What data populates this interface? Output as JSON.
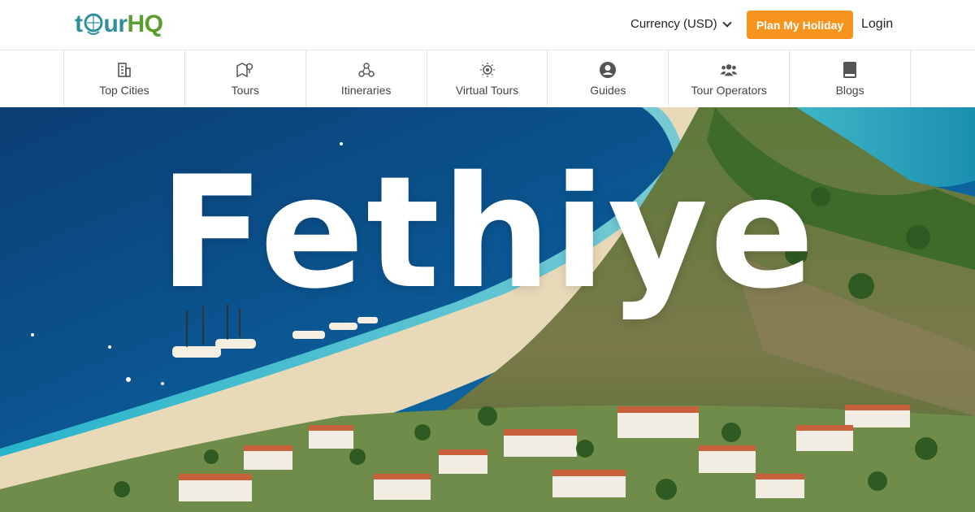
{
  "header": {
    "logo_text": "tourHQ",
    "currency_label": "Currency (USD)",
    "plan_button": "Plan My Holiday",
    "login": "Login"
  },
  "nav": {
    "items": [
      {
        "label": "Top Cities",
        "icon": "building-icon"
      },
      {
        "label": "Tours",
        "icon": "map-pin-icon"
      },
      {
        "label": "Itineraries",
        "icon": "network-icon"
      },
      {
        "label": "Virtual Tours",
        "icon": "sun-icon"
      },
      {
        "label": "Guides",
        "icon": "user-circle-icon"
      },
      {
        "label": "Tour Operators",
        "icon": "users-icon"
      },
      {
        "label": "Blogs",
        "icon": "book-icon"
      }
    ]
  },
  "hero": {
    "title": "Fethiye",
    "image": "aerial view of beach, turquoise lagoon, boats and wooded hills"
  },
  "colors": {
    "accent": "#f7941d",
    "logo_teal": "#2f8f9d",
    "logo_green": "#5b9e2e"
  }
}
